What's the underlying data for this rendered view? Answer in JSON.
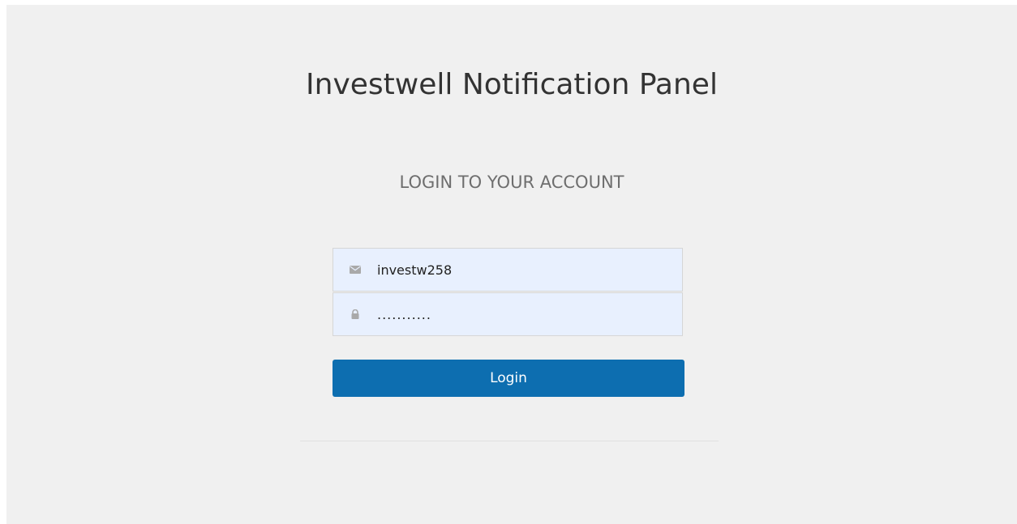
{
  "page": {
    "title": "Investwell Notification Panel",
    "subtitle": "LOGIN TO YOUR ACCOUNT"
  },
  "form": {
    "username": {
      "icon": "envelope-icon",
      "value": "investw258"
    },
    "password": {
      "icon": "lock-icon",
      "value": "..........."
    },
    "login_label": "Login"
  },
  "colors": {
    "background": "#f0f0f0",
    "input_fill": "#e8f0fe",
    "button": "#0d6eb0",
    "title_text": "#333333",
    "subtitle_text": "#6e6e6e"
  }
}
